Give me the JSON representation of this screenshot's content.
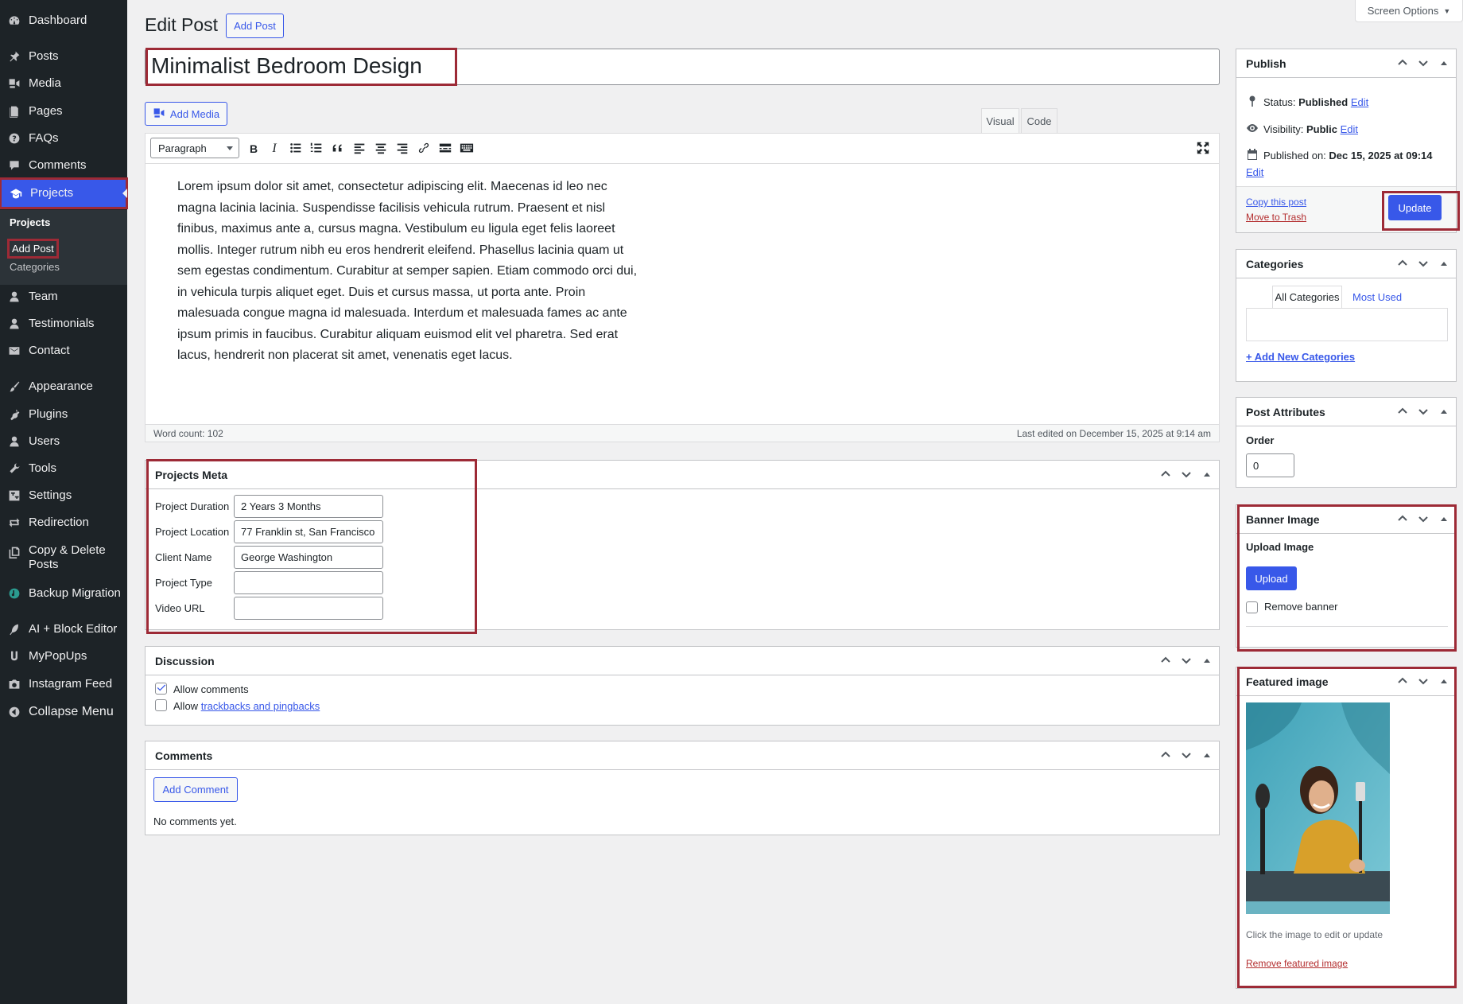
{
  "sidebar": {
    "items": [
      {
        "label": "Dashboard",
        "icon": "dashboard-icon"
      },
      {
        "label": "Posts",
        "icon": "pin-icon"
      },
      {
        "label": "Media",
        "icon": "media-icon"
      },
      {
        "label": "Pages",
        "icon": "pages-icon"
      },
      {
        "label": "FAQs",
        "icon": "help-icon"
      },
      {
        "label": "Comments",
        "icon": "comment-icon"
      },
      {
        "label": "Projects",
        "icon": "portfolio-icon"
      },
      {
        "label": "Team",
        "icon": "user-icon"
      },
      {
        "label": "Testimonials",
        "icon": "user-icon"
      },
      {
        "label": "Contact",
        "icon": "mail-icon"
      },
      {
        "label": "Appearance",
        "icon": "brush-icon"
      },
      {
        "label": "Plugins",
        "icon": "plugin-icon"
      },
      {
        "label": "Users",
        "icon": "user-icon"
      },
      {
        "label": "Tools",
        "icon": "wrench-icon"
      },
      {
        "label": "Settings",
        "icon": "settings-icon"
      },
      {
        "label": "Redirection",
        "icon": "redirect-icon"
      },
      {
        "label": "Copy & Delete",
        "label2": "Posts",
        "icon": "copy-icon"
      },
      {
        "label": "Backup Migration",
        "icon": "backup-icon"
      },
      {
        "label": "AI + Block Editor",
        "icon": "feather-icon"
      },
      {
        "label": "MyPopUps",
        "icon": "u-icon"
      },
      {
        "label": "Instagram Feed",
        "icon": "camera-icon"
      },
      {
        "label": "Collapse Menu",
        "icon": "collapse-icon"
      }
    ],
    "submenu": {
      "heading": "Projects",
      "add": "Add Post",
      "categories": "Categories"
    }
  },
  "header": {
    "title": "Edit Post",
    "add_post": "Add Post",
    "screen_options": "Screen Options"
  },
  "post": {
    "title": "Minimalist Bedroom Design",
    "content": "Lorem ipsum dolor sit amet, consectetur adipiscing elit. Maecenas id leo nec magna lacinia lacinia. Suspendisse facilisis vehicula rutrum. Praesent et nisl finibus, maximus ante a, cursus magna. Vestibulum eu ligula eget felis laoreet mollis. Integer rutrum nibh eu eros hendrerit eleifend. Phasellus lacinia quam ut sem egestas condimentum. Curabitur at semper sapien. Etiam commodo orci dui, in vehicula turpis aliquet eget. Duis et cursus massa, ut porta ante. Proin malesuada congue magna id malesuada. Interdum et malesuada fames ac ante ipsum primis in faucibus. Curabitur aliquam euismod elit vel pharetra. Sed erat lacus, hendrerit non placerat sit amet, venenatis eget lacus."
  },
  "editor": {
    "add_media": "Add Media",
    "tab_visual": "Visual",
    "tab_code": "Code",
    "format": "Paragraph",
    "word_count": "Word count: 102",
    "last_edited": "Last edited on December 15, 2025 at 9:14 am"
  },
  "projects_meta": {
    "title": "Projects Meta",
    "fields": [
      {
        "label": "Project Duration",
        "value": "2 Years 3 Months"
      },
      {
        "label": "Project Location",
        "value": "77 Franklin st, San Francisco"
      },
      {
        "label": "Client Name",
        "value": "George Washington"
      },
      {
        "label": "Project Type",
        "value": ""
      },
      {
        "label": "Video URL",
        "value": ""
      }
    ]
  },
  "discussion": {
    "title": "Discussion",
    "allow_comments": "Allow comments",
    "allow_prefix": "Allow",
    "trackbacks": "trackbacks and pingbacks"
  },
  "comments": {
    "title": "Comments",
    "add_comment": "Add Comment",
    "none": "No comments yet."
  },
  "publish": {
    "title": "Publish",
    "status_label": "Status:",
    "status_value": "Published",
    "visibility_label": "Visibility:",
    "visibility_value": "Public",
    "published_label": "Published on:",
    "published_value": "Dec 15, 2025 at 09:14",
    "edit": "Edit",
    "copy": "Copy this post",
    "trash": "Move to Trash",
    "update": "Update"
  },
  "categories": {
    "title": "Categories",
    "tab_all": "All Categories",
    "tab_most": "Most Used",
    "add_new": "+ Add New Categories"
  },
  "attributes": {
    "title": "Post Attributes",
    "order_label": "Order",
    "order_value": "0"
  },
  "banner": {
    "title": "Banner Image",
    "upload_label": "Upload Image",
    "upload_btn": "Upload",
    "remove": "Remove banner"
  },
  "featured": {
    "title": "Featured image",
    "hint": "Click the image to edit or update",
    "remove": "Remove featured image"
  },
  "colors": {
    "accent": "#3858e9",
    "highlight": "#9d2a36",
    "sidebar": "#1d2327"
  }
}
